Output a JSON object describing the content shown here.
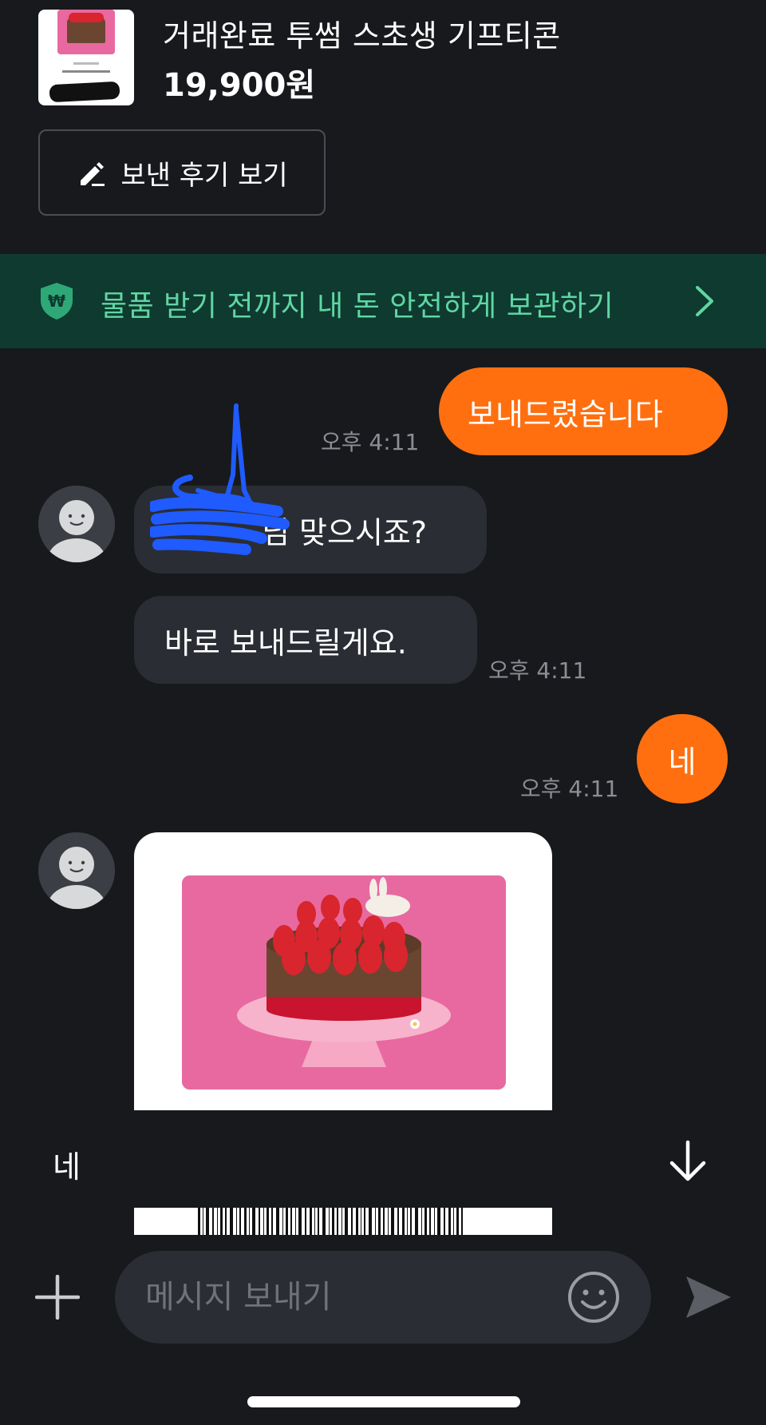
{
  "product": {
    "title": "거래완료 투썸 스초생 기프티콘",
    "price": "19,900원",
    "review_button": "보낸 후기 보기"
  },
  "banner": {
    "text": "물품 받기 전까지 내 돈 안전하게 보관하기"
  },
  "messages": [
    {
      "sender": "me",
      "text": "보내드렸습니다",
      "time": "오후 4:11"
    },
    {
      "sender": "other",
      "text": "님 맞으시죠?"
    },
    {
      "sender": "other",
      "text": "바로 보내드릴게요.",
      "time": "오후 4:11"
    },
    {
      "sender": "me",
      "text": "네",
      "time": "오후 4:11"
    }
  ],
  "quick_reply": {
    "text": "네"
  },
  "input": {
    "placeholder": "메시지 보내기"
  },
  "colors": {
    "background": "#17191c",
    "accent_orange": "#ff6f0f",
    "bubble_other": "#2a2d33",
    "banner_bg": "#0f3a2f",
    "banner_text": "#5fd6a4",
    "time_gray": "#8b8e94"
  },
  "icons": {
    "review": "pencil-icon",
    "banner_left": "shield-won-icon",
    "banner_right": "chevron-right-icon",
    "scroll": "arrow-down-icon",
    "attach": "plus-icon",
    "emoji": "smiley-icon",
    "send": "send-icon"
  }
}
